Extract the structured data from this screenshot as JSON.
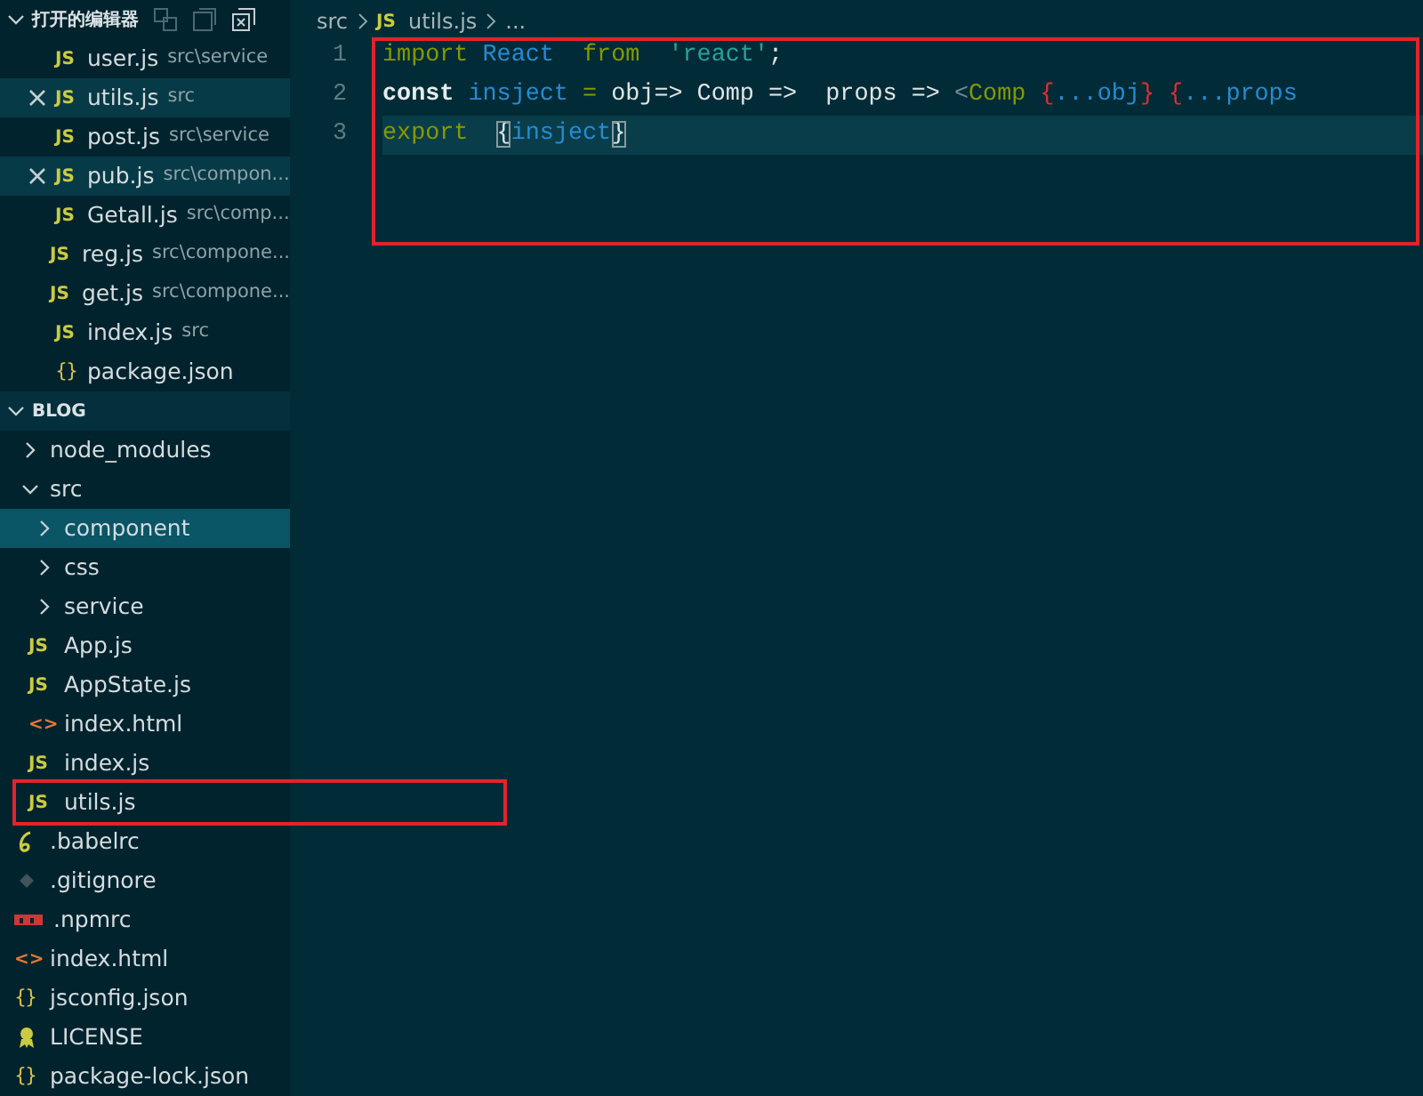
{
  "open_editors": {
    "title": "打开的编辑器",
    "expanded": true,
    "items": [
      {
        "name": "user.js",
        "path": "src\\service",
        "kind": "js",
        "glyph": "JS",
        "selected": false
      },
      {
        "name": "utils.js",
        "path": "src",
        "kind": "js",
        "glyph": "JS",
        "selected": true
      },
      {
        "name": "post.js",
        "path": "src\\service",
        "kind": "js",
        "glyph": "JS",
        "selected": false
      },
      {
        "name": "pub.js",
        "path": "src\\compon...",
        "kind": "js",
        "glyph": "JS",
        "selected": true
      },
      {
        "name": "Getall.js",
        "path": "src\\comp...",
        "kind": "js",
        "glyph": "JS",
        "selected": false
      },
      {
        "name": "reg.js",
        "path": "src\\compone...",
        "kind": "js",
        "glyph": "JS",
        "selected": false
      },
      {
        "name": "get.js",
        "path": "src\\compone...",
        "kind": "js",
        "glyph": "JS",
        "selected": false
      },
      {
        "name": "index.js",
        "path": "src",
        "kind": "js",
        "glyph": "JS",
        "selected": false
      },
      {
        "name": "package.json",
        "kind": "json",
        "glyph": "{}",
        "selected": false
      }
    ]
  },
  "explorer": {
    "title": "BLOG",
    "expanded": true,
    "items": [
      {
        "name": "node_modules",
        "kind": "folder",
        "expanded": false,
        "selected": false
      },
      {
        "name": "src",
        "kind": "folder",
        "expanded": true,
        "selected": false,
        "children": [
          {
            "name": "component",
            "kind": "folder",
            "expanded": false,
            "selected": true
          },
          {
            "name": "css",
            "kind": "folder",
            "expanded": false,
            "selected": false
          },
          {
            "name": "service",
            "kind": "folder",
            "expanded": false,
            "selected": false
          },
          {
            "name": "App.js",
            "kind": "js",
            "glyph": "JS",
            "selected": false
          },
          {
            "name": "AppState.js",
            "kind": "js",
            "glyph": "JS",
            "selected": false
          },
          {
            "name": "index.html",
            "kind": "html",
            "glyph": "<>",
            "selected": false
          },
          {
            "name": "index.js",
            "kind": "js",
            "glyph": "JS",
            "selected": false
          },
          {
            "name": "utils.js",
            "kind": "js",
            "glyph": "JS",
            "selected": false,
            "annotated": true
          }
        ]
      },
      {
        "name": ".babelrc",
        "kind": "babel",
        "selected": false
      },
      {
        "name": ".gitignore",
        "kind": "git",
        "selected": false
      },
      {
        "name": ".npmrc",
        "kind": "npm",
        "selected": false
      },
      {
        "name": "index.html",
        "kind": "html",
        "glyph": "<>",
        "selected": false
      },
      {
        "name": "jsconfig.json",
        "kind": "json",
        "glyph": "{}",
        "selected": false
      },
      {
        "name": "LICENSE",
        "kind": "license",
        "selected": false
      },
      {
        "name": "package-lock.json",
        "kind": "json",
        "glyph": "{}",
        "selected": false
      }
    ]
  },
  "breadcrumb": [
    {
      "text": "src",
      "kind": "folder"
    },
    {
      "text": "utils.js",
      "kind": "file",
      "glyph": "JS"
    },
    {
      "text": "...",
      "kind": "more"
    }
  ],
  "editor": {
    "annotated": true,
    "lines": [
      {
        "number": "1",
        "current": false,
        "tokens": [
          {
            "text": "import",
            "kind": "keyword"
          },
          {
            "text": " React",
            "kind": "ident"
          },
          {
            "text": "  from",
            "kind": "keyword"
          },
          {
            "text": "  'react'",
            "kind": "string"
          },
          {
            "text": ";",
            "kind": "plain"
          }
        ]
      },
      {
        "number": "2",
        "current": false,
        "tokens": [
          {
            "text": "const",
            "kind": "storage"
          },
          {
            "text": " insject",
            "kind": "ident"
          },
          {
            "text": " =",
            "kind": "keyword"
          },
          {
            "text": " obj=> Comp =>  props => ",
            "kind": "plain"
          },
          {
            "text": "<",
            "kind": "dim"
          },
          {
            "text": "Comp",
            "kind": "keyword"
          },
          {
            "text": " {",
            "kind": "brace"
          },
          {
            "text": "...obj",
            "kind": "ident"
          },
          {
            "text": "}",
            "kind": "brace"
          },
          {
            "text": " {",
            "kind": "brace"
          },
          {
            "text": "...props",
            "kind": "ident"
          }
        ]
      },
      {
        "number": "3",
        "current": true,
        "tokens": [
          {
            "text": "export",
            "kind": "keyword"
          },
          {
            "text": "  {",
            "kind": "match"
          },
          {
            "text": "insject",
            "kind": "ident"
          },
          {
            "text": "}",
            "kind": "match"
          }
        ]
      }
    ]
  }
}
